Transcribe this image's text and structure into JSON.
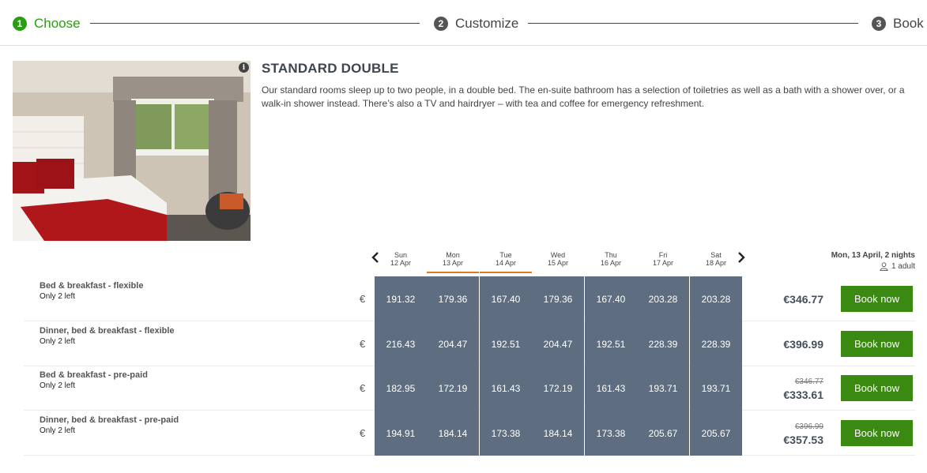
{
  "stepper": {
    "steps": [
      {
        "number": "1",
        "label": "Choose",
        "active": true
      },
      {
        "number": "2",
        "label": "Customize",
        "active": false
      },
      {
        "number": "3",
        "label": "Book",
        "active": false
      }
    ]
  },
  "room": {
    "title": "STANDARD DOUBLE",
    "description": "Our standard rooms sleep up to two people, in a double bed. The en-suite bathroom has a selection of toiletries as well as a bath with a shower over, or a walk-in shower instead. There’s also a TV and hairdryer – with tea and coffee for emergency refreshment.",
    "info_icon": "i"
  },
  "calendar": {
    "prev_icon": "‹",
    "next_icon": "›",
    "days": [
      {
        "day": "Sun",
        "date": "12 Apr",
        "selected": false
      },
      {
        "day": "Mon",
        "date": "13 Apr",
        "selected": true
      },
      {
        "day": "Tue",
        "date": "14 Apr",
        "selected": true
      },
      {
        "day": "Wed",
        "date": "15 Apr",
        "selected": false
      },
      {
        "day": "Thu",
        "date": "16 Apr",
        "selected": false
      },
      {
        "day": "Fri",
        "date": "17 Apr",
        "selected": false
      },
      {
        "day": "Sat",
        "date": "18 Apr",
        "selected": false
      }
    ]
  },
  "summary": {
    "stay": "Mon, 13 April, 2 nights",
    "guests": "1 adult"
  },
  "currency_symbol": "€",
  "rates": [
    {
      "name": "Bed & breakfast - flexible",
      "availability": "Only 2 left",
      "prices": [
        "191.32",
        "179.36",
        "167.40",
        "179.36",
        "167.40",
        "203.28",
        "203.28"
      ],
      "old_total": "",
      "total": "€346.77",
      "button": "Book now"
    },
    {
      "name": "Dinner, bed & breakfast - flexible",
      "availability": "Only 2 left",
      "prices": [
        "216.43",
        "204.47",
        "192.51",
        "204.47",
        "192.51",
        "228.39",
        "228.39"
      ],
      "old_total": "",
      "total": "€396.99",
      "button": "Book now"
    },
    {
      "name": "Bed & breakfast - pre-paid",
      "availability": "Only 2 left",
      "prices": [
        "182.95",
        "172.19",
        "161.43",
        "172.19",
        "161.43",
        "193.71",
        "193.71"
      ],
      "old_total": "€346.77",
      "total": "€333.61",
      "button": "Book now"
    },
    {
      "name": "Dinner, bed & breakfast - pre-paid",
      "availability": "Only 2 left",
      "prices": [
        "194.91",
        "184.14",
        "173.38",
        "184.14",
        "173.38",
        "205.67",
        "205.67"
      ],
      "old_total": "€396.99",
      "total": "€357.53",
      "button": "Book now"
    }
  ],
  "colors": {
    "active_step": "#2a9d12",
    "price_cell": "#5e6e80",
    "book_button": "#3a8a12",
    "selected_day_underline": "#e07a1a"
  }
}
